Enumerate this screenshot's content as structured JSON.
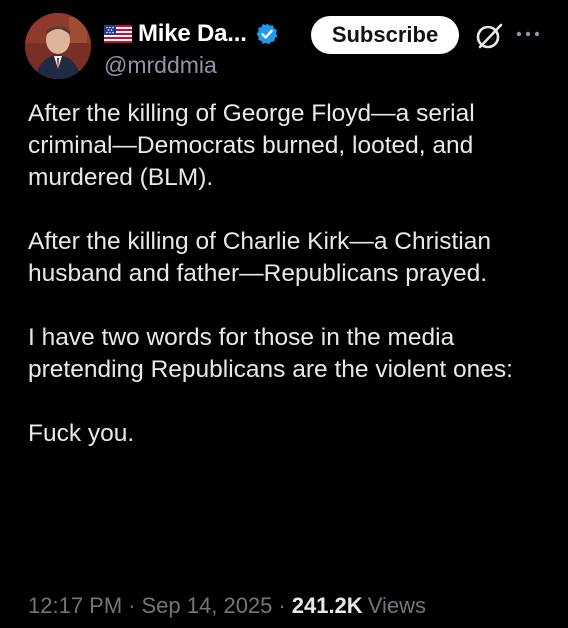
{
  "author": {
    "display_name": "Mike Da...",
    "handle": "@mrddmia",
    "flag_icon": "us-flag-icon",
    "verified_icon": "verified-badge-icon",
    "avatar_icon": "profile-avatar"
  },
  "actions": {
    "subscribe_label": "Subscribe",
    "grok_icon": "grok-icon",
    "more_icon": "more-options-icon"
  },
  "tweet": {
    "paragraphs": [
      "After the killing of George Floyd—a serial criminal—Democrats burned, looted, and murdered (BLM).",
      "After the killing of Charlie Kirk—a Christian husband and father—Republicans prayed.",
      "I have two words for those in the media pretending Republicans are the violent ones:",
      "Fuck you."
    ],
    "time": "12:17 PM",
    "date": "Sep 14, 2025",
    "separator": "·",
    "views_count": "241.2K",
    "views_label": "Views"
  },
  "colors": {
    "background": "#000000",
    "text_primary": "#e7e9ea",
    "text_secondary": "#71767b",
    "verified_blue": "#1d9bf0",
    "subscribe_bg": "#ffffff"
  }
}
